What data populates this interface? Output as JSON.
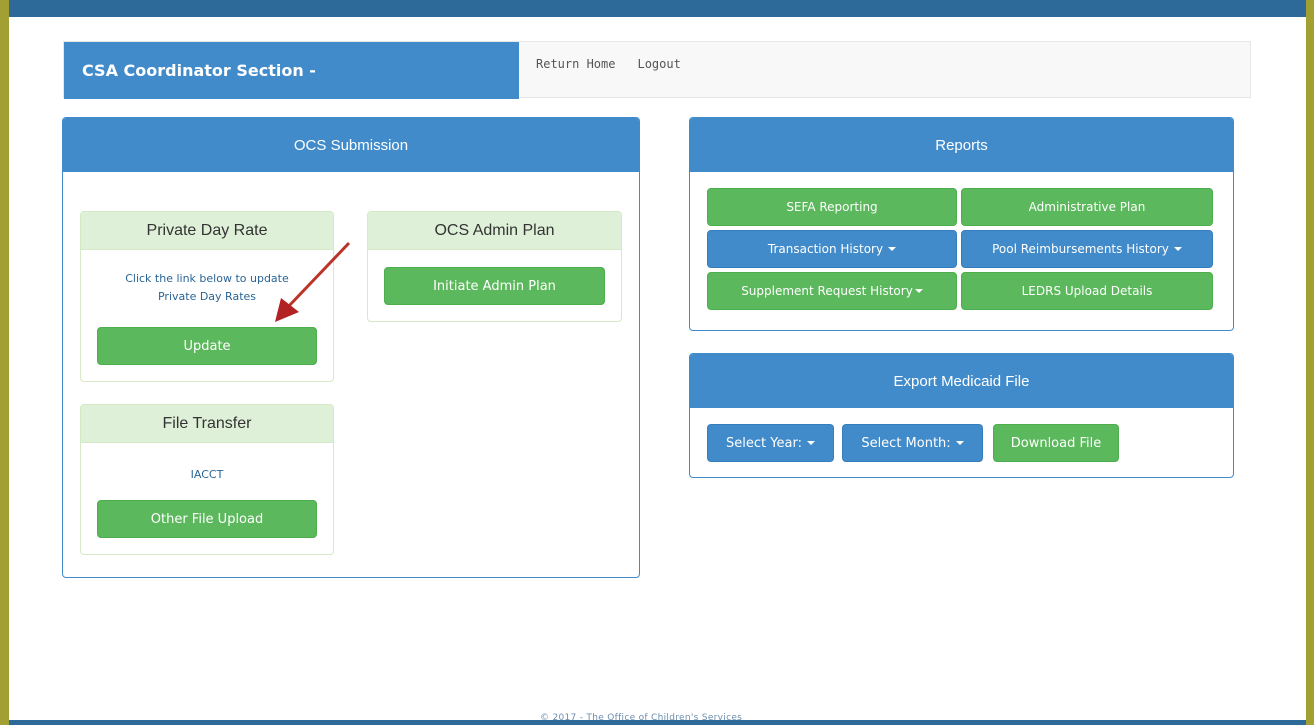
{
  "header": {
    "brand": "CSA Coordinator Section -",
    "nav": [
      "Return Home",
      "Logout"
    ]
  },
  "ocs": {
    "title": "OCS Submission",
    "private_day_rate": {
      "title": "Private Day Rate",
      "text": "Click the link below to update Private Day Rates",
      "button": "Update"
    },
    "admin_plan": {
      "title": "OCS Admin Plan",
      "button": "Initiate Admin Plan"
    },
    "file_transfer": {
      "title": "File Transfer",
      "link": "IACCT",
      "button": "Other File Upload"
    }
  },
  "reports": {
    "title": "Reports",
    "buttons": [
      "SEFA Reporting",
      "Administrative Plan",
      "Transaction History",
      "Pool Reimbursements History",
      "Supplement Request History",
      "LEDRS Upload Details"
    ]
  },
  "medicaid": {
    "title": "Export Medicaid File",
    "select_year": "Select Year:",
    "select_month": "Select Month:",
    "download": "Download File"
  },
  "footer": "© 2017 - The Office of Children's Services",
  "colors": {
    "primary": "#428bca",
    "success": "#5cb85c",
    "frame": "#a3a033",
    "arrow": "#c0392b"
  }
}
